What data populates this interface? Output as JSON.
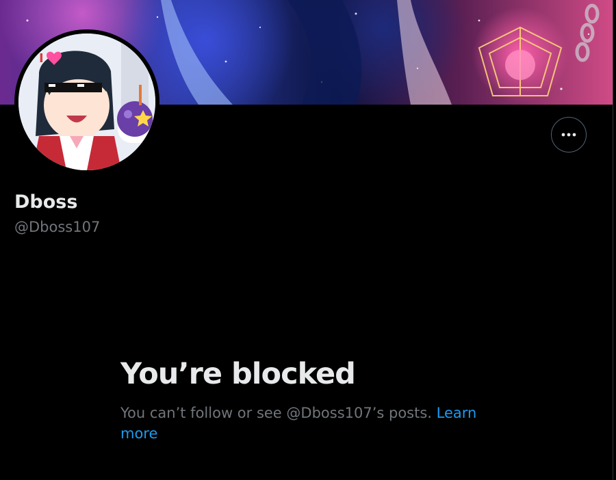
{
  "profile": {
    "display_name": "Dboss",
    "handle": "@Dboss107"
  },
  "actions": {
    "more_icon": "ellipsis-icon"
  },
  "blocked": {
    "title": "You’re blocked",
    "description": "You can’t follow or see @Dboss107’s posts.",
    "learn_more_label": "Learn more"
  },
  "colors": {
    "background": "#000000",
    "primary_text": "#e7e9ea",
    "secondary_text": "#71767b",
    "link": "#1d9bf0",
    "border": "#536471"
  }
}
